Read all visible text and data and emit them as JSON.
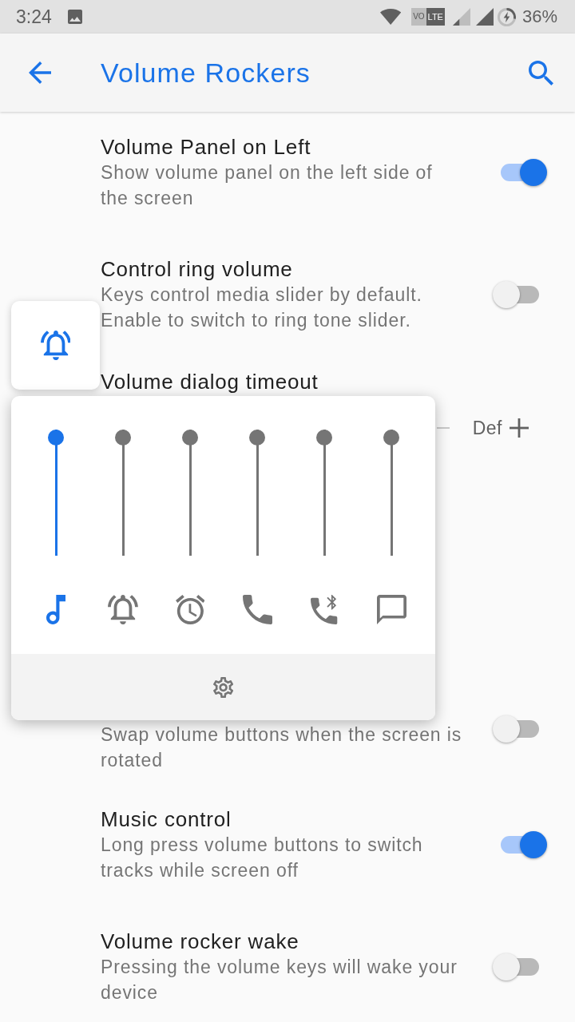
{
  "status_bar": {
    "time": "3:24",
    "badge": [
      "VO",
      "LTE"
    ],
    "battery": "36%"
  },
  "app_bar": {
    "title": "Volume Rockers"
  },
  "settings": [
    {
      "kind": "toggle",
      "title": "Volume Panel on Left",
      "summary": [
        "Show volume panel on the left side of",
        "the screen"
      ],
      "on": true
    },
    {
      "kind": "toggle",
      "title": "Control ring volume",
      "summary": [
        "Keys control media slider by default.",
        "Enable to switch to ring tone slider."
      ],
      "on": false
    },
    {
      "kind": "stepper",
      "title": "Volume dialog timeout",
      "value": "Def"
    },
    {
      "kind": "toggle",
      "summary": [
        "Swap volume buttons when the screen is",
        "rotated"
      ],
      "on": false
    },
    {
      "kind": "toggle",
      "title": "Music control",
      "summary": [
        "Long press volume buttons to switch",
        "tracks while screen off"
      ],
      "on": true
    },
    {
      "kind": "toggle",
      "title": "Volume rocker wake",
      "summary": [
        "Pressing the volume keys will wake your",
        "device"
      ],
      "on": false
    }
  ],
  "volume_panel": {
    "streams": [
      {
        "kind": "music",
        "selected": true,
        "level": 1
      },
      {
        "kind": "ring",
        "selected": false,
        "level": 1
      },
      {
        "kind": "alarm",
        "selected": false,
        "level": 1
      },
      {
        "kind": "call",
        "selected": false,
        "level": 1
      },
      {
        "kind": "bluetooth_call",
        "selected": false,
        "level": 1
      },
      {
        "kind": "notification",
        "selected": false,
        "level": 1
      }
    ]
  }
}
